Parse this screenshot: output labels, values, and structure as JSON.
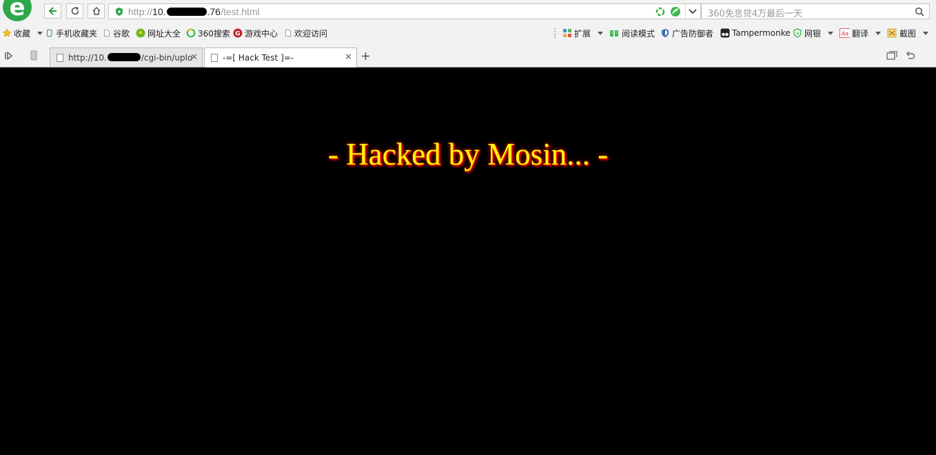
{
  "browser": {
    "url": {
      "prefix": "http://",
      "host_start": "10.",
      "host_end": ".76",
      "path": "/test.html"
    },
    "search_placeholder": "360免息贷4万最后一天",
    "bookmarks": [
      {
        "label": "收藏",
        "icon": "star-icon"
      },
      {
        "label": "手机收藏夹",
        "icon": "phone-icon"
      },
      {
        "label": "谷歌",
        "icon": "page-icon"
      },
      {
        "label": "网址大全",
        "icon": "site-nav-icon"
      },
      {
        "label": "360搜索",
        "icon": "360-search-icon"
      },
      {
        "label": "游戏中心",
        "icon": "game-icon"
      },
      {
        "label": "欢迎访问",
        "icon": "page-icon"
      }
    ],
    "toolbar_right": [
      {
        "label": "扩展",
        "icon": "extensions-icon"
      },
      {
        "label": "阅读模式",
        "icon": "book-icon"
      },
      {
        "label": "广告防御者",
        "icon": "shield-icon"
      },
      {
        "label": "Tampermonke",
        "icon": "tampermonkey-icon"
      },
      {
        "label": "网银",
        "icon": "bank-icon"
      },
      {
        "label": "翻译",
        "icon": "translate-icon"
      },
      {
        "label": "截图",
        "icon": "screenshot-icon"
      }
    ],
    "tabs": [
      {
        "title_prefix": "http://10.",
        "title_suffix": "/cgi-bin/uplo",
        "active": false
      },
      {
        "title": "-=[ Hack Test ]=-",
        "active": true
      }
    ]
  },
  "page": {
    "headline": "- Hacked by Mosin... -",
    "colors": {
      "background": "#000000",
      "text": "#ffff00",
      "glow": "#ff0000"
    }
  }
}
